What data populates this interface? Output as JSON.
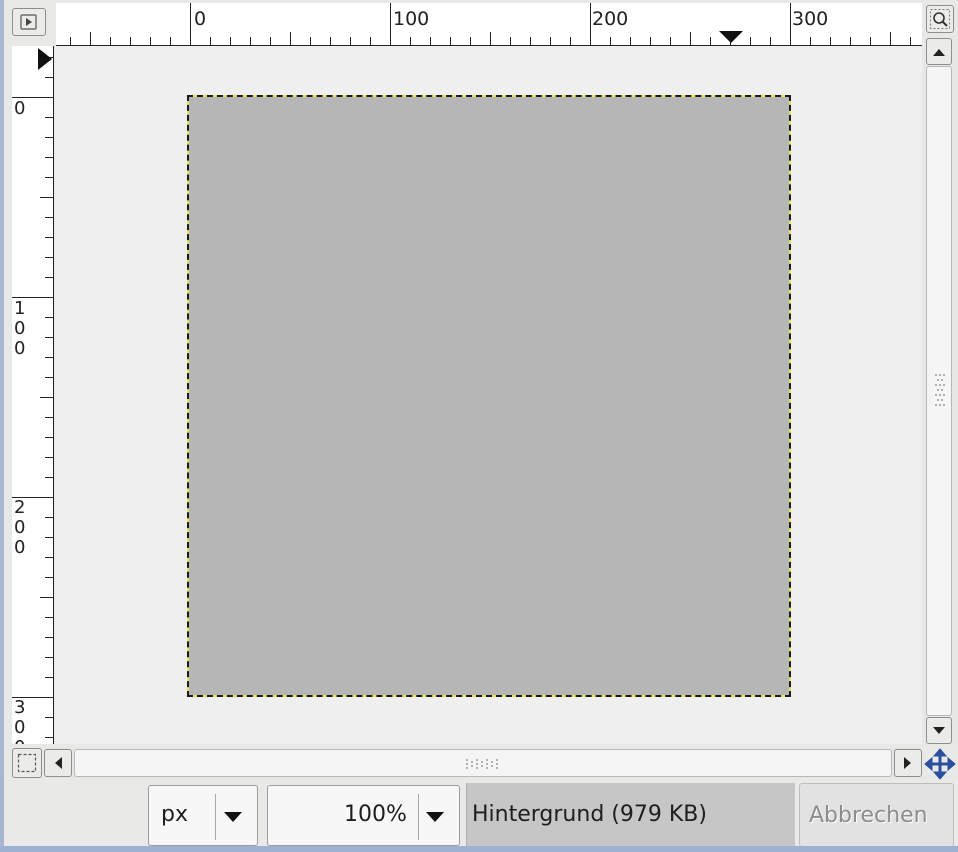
{
  "rulers": {
    "horizontal_labels": [
      "0",
      "100",
      "200",
      "300"
    ],
    "vertical_labels": [
      "0",
      "100",
      "200",
      "300"
    ]
  },
  "image": {
    "fill_color": "#b7b6b7",
    "selection_colors": [
      "#1a1a1a",
      "#e8e35a"
    ]
  },
  "statusbar": {
    "unit": "px",
    "zoom": "100%",
    "layer_info": "Hintergrund (979 KB)",
    "cancel_label": "Abbrechen"
  },
  "icons": {
    "menu": "triangle-play-icon",
    "zoom_fit": "magnifier-icon",
    "quick_mask": "dashed-square-icon",
    "navigate": "four-way-arrows-icon",
    "navigate_color": "#2a4f9e"
  }
}
